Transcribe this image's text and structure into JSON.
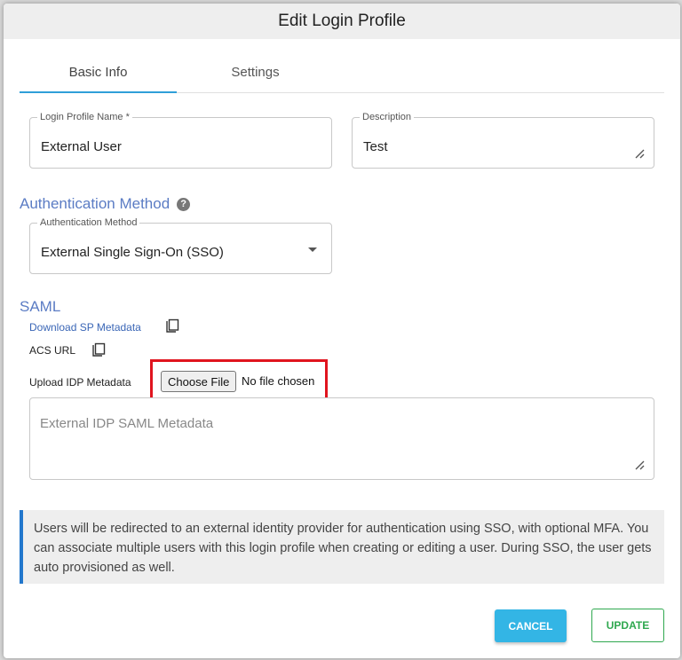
{
  "dialog": {
    "title": "Edit Login Profile"
  },
  "tabs": [
    {
      "label": "Basic Info",
      "active": true
    },
    {
      "label": "Settings",
      "active": false
    }
  ],
  "form": {
    "profile_name": {
      "label": "Login Profile Name *",
      "value": "External User"
    },
    "description": {
      "label": "Description",
      "value": "Test"
    }
  },
  "auth": {
    "section_title": "Authentication Method",
    "help_icon": "?",
    "select": {
      "label": "Authentication Method",
      "value": "External Single Sign-On (SSO)"
    }
  },
  "saml": {
    "section_title": "SAML",
    "download_link": "Download SP Metadata",
    "acs_url": "ACS URL",
    "upload_label": "Upload IDP Metadata",
    "choose_file": "Choose File",
    "file_status": "No file chosen",
    "metadata_placeholder": "External IDP SAML Metadata"
  },
  "info": {
    "text": "Users will be redirected to an external identity provider for authentication using SSO, with optional MFA. You can associate multiple users with this login profile when creating or editing a user. During SSO, the user gets auto provisioned as well."
  },
  "actions": {
    "cancel": "CANCEL",
    "update": "UPDATE"
  },
  "colors": {
    "accent": "#2f9fd8",
    "section_title": "#5b7cc4",
    "highlight": "#e0141e",
    "info_border": "#2277cc",
    "cancel_bg": "#33b5e5",
    "update": "#2fa84f"
  }
}
